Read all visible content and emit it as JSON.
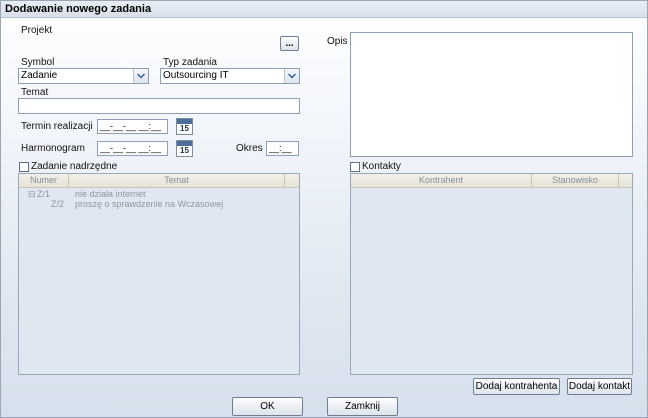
{
  "window": {
    "title": "Dodawanie nowego zadania"
  },
  "form": {
    "project_label": "Projekt",
    "project_button": "...",
    "symbol_label": "Symbol",
    "symbol_value": "Zadanie",
    "type_label": "Typ zadania",
    "type_value": "Outsourcing IT",
    "subject_label": "Temat",
    "subject_value": "",
    "deadline_label": "Termin realizacji",
    "deadline_value": "__-__-__ __:__",
    "schedule_label": "Harmonogram",
    "schedule_value": "__-__-__ __:__",
    "calendar_day": "15",
    "period_label": "Okres",
    "period_value": "__:__",
    "description_label": "Opis",
    "description_value": ""
  },
  "parent_task": {
    "checkbox_label": "Zadanie nadrzędne",
    "columns": [
      "Numer",
      "Temat"
    ],
    "rows": [
      {
        "expander": "⊟",
        "number": "Z/1",
        "subject": "nie działa internet"
      },
      {
        "expander": "",
        "number": "Z/2",
        "subject": "proszę o sprawdzenie na Wczasowej"
      }
    ]
  },
  "contacts": {
    "checkbox_label": "Kontakty",
    "columns": [
      "Kontrahent",
      "Stanowisko"
    ]
  },
  "buttons": {
    "add_contractor": "Dodaj kontrahenta",
    "add_contact": "Dodaj kontakt",
    "ok": "OK",
    "close": "Zamknij"
  }
}
